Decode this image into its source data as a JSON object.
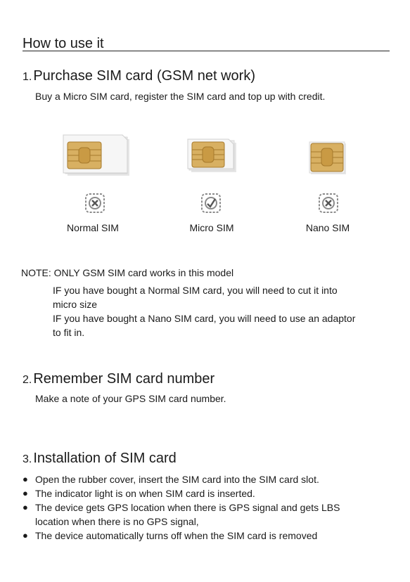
{
  "page": {
    "title": "How to use it"
  },
  "section1": {
    "number": "1.",
    "title": "Purchase SIM card (GSM net work)",
    "description": "Buy a Micro SIM card, register the SIM card and top up with credit."
  },
  "sims": [
    {
      "label": "Normal SIM",
      "status": "not-supported",
      "icon": "cross-icon"
    },
    {
      "label": "Micro SIM",
      "status": "supported",
      "icon": "check-icon"
    },
    {
      "label": "Nano SIM",
      "status": "not-supported",
      "icon": "cross-icon"
    }
  ],
  "note": {
    "prefix": "NOTE: ONLY GSM SIM card works in this model",
    "line1": "IF you have bought a Normal SIM card, you will need to cut it into",
    "line2": "micro size",
    "line3": "IF you have bought a Nano SIM card, you will need to use an adaptor",
    "line4": "to fit in."
  },
  "section2": {
    "number": "2.",
    "title": "Remember SIM card number",
    "description": "Make a note of your GPS SIM card number."
  },
  "section3": {
    "number": "3.",
    "title": "Installation of SIM card",
    "bullet_symbol": "●",
    "bullets": [
      {
        "text": "Open the rubber cover, insert the SIM card into the SIM card slot."
      },
      {
        "text": "The indicator light is on when SIM card is inserted."
      },
      {
        "text": "The device gets GPS location when there is GPS signal and gets LBS",
        "continuation": "location when there is no GPS signal,"
      },
      {
        "text": "The device automatically turns off when the SIM card is removed"
      }
    ]
  },
  "colors": {
    "chip_gold": "#d8b062",
    "chip_dark": "#a67a2c",
    "card": "#f4f4f4",
    "icon_gray": "#8a8a8a"
  }
}
